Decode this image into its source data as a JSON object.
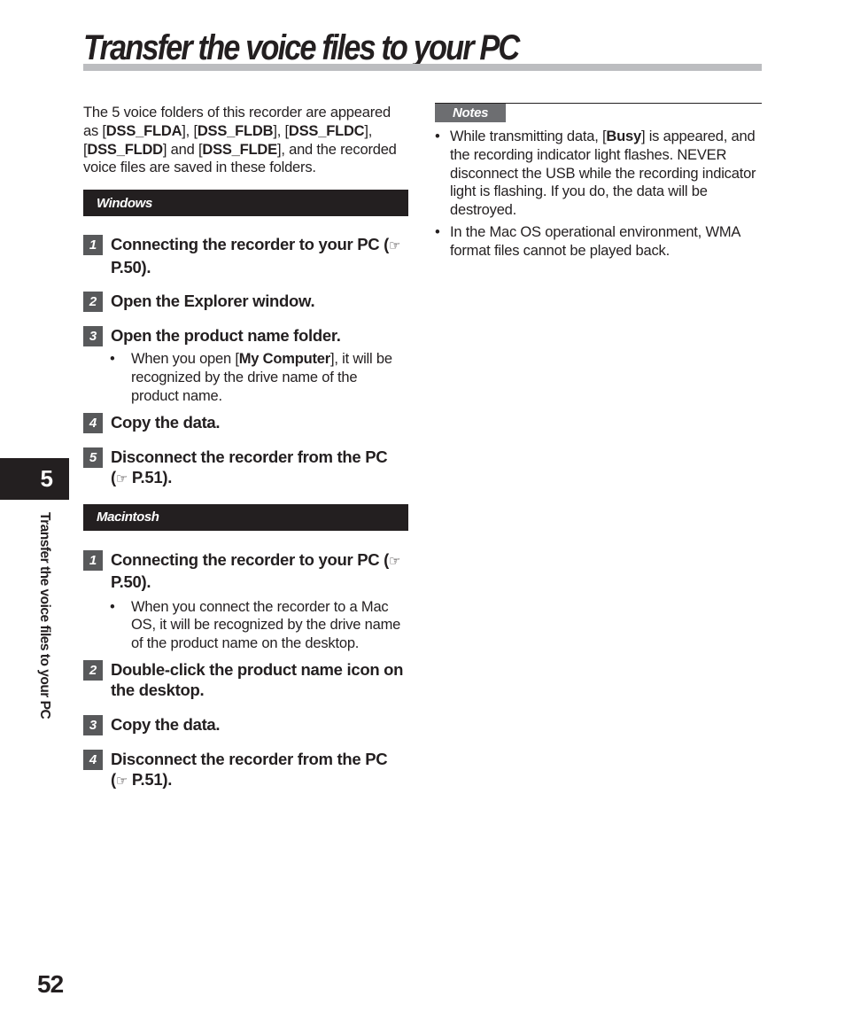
{
  "page": {
    "title": "Transfer the voice files to your PC",
    "chapter_number": "5",
    "chapter_side_label": "Transfer the voice files to your PC",
    "page_number": "52"
  },
  "intro": {
    "parts": [
      {
        "text": "The 5 voice folders of this recorder are appeared as [",
        "bold": false
      },
      {
        "text": "DSS_FLDA",
        "bold": true
      },
      {
        "text": "], [",
        "bold": false
      },
      {
        "text": "DSS_FLDB",
        "bold": true
      },
      {
        "text": "], [",
        "bold": false
      },
      {
        "text": "DSS_FLDC",
        "bold": true
      },
      {
        "text": "], [",
        "bold": false
      },
      {
        "text": "DSS_FLDD",
        "bold": true
      },
      {
        "text": "] and [",
        "bold": false
      },
      {
        "text": "DSS_FLDE",
        "bold": true
      },
      {
        "text": "], and the recorded voice files are saved in these folders.",
        "bold": false
      }
    ]
  },
  "icons": {
    "reference": "☞"
  },
  "windows": {
    "heading": "Windows",
    "steps": [
      {
        "num": "1",
        "text": "Connecting the recorder to your PC (",
        "ref": "P.50)."
      },
      {
        "num": "2",
        "text": "Open the Explorer window."
      },
      {
        "num": "3",
        "text": "Open the product name folder.",
        "bullet": {
          "pre": "When you open [",
          "bold": "My Computer",
          "post": "], it will be recognized by the drive name of the product name."
        }
      },
      {
        "num": "4",
        "text": "Copy the data."
      },
      {
        "num": "5",
        "text": "Disconnect the recorder from the PC (",
        "ref": "P.51)."
      }
    ]
  },
  "macintosh": {
    "heading": "Macintosh",
    "steps": [
      {
        "num": "1",
        "text": "Connecting the recorder to your PC (",
        "ref": "P.50).",
        "bullet": {
          "text": "When you connect the recorder to a Mac OS, it will be recognized by the drive name of the product name on the desktop."
        }
      },
      {
        "num": "2",
        "text": "Double-click the product name icon on the desktop."
      },
      {
        "num": "3",
        "text": "Copy the data."
      },
      {
        "num": "4",
        "text": "Disconnect the recorder from the PC (",
        "ref": "P.51)."
      }
    ]
  },
  "notes": {
    "heading": "Notes",
    "items": [
      {
        "pre": "While transmitting data, [",
        "bold": "Busy",
        "post": "] is appeared, and the recording indicator light flashes. NEVER disconnect the USB while the recording indicator light is flashing. If you do, the data will be destroyed."
      },
      {
        "pre": "In the Mac OS operational environment, WMA format files cannot be played back.",
        "bold": "",
        "post": ""
      }
    ]
  },
  "bullet_glyph": "•",
  "colors": {
    "text": "#231f20",
    "title_bar": "#bcbdc0",
    "section_bar": "#231f20",
    "step_badge": "#58595b",
    "notes_tag": "#6d6e71"
  }
}
